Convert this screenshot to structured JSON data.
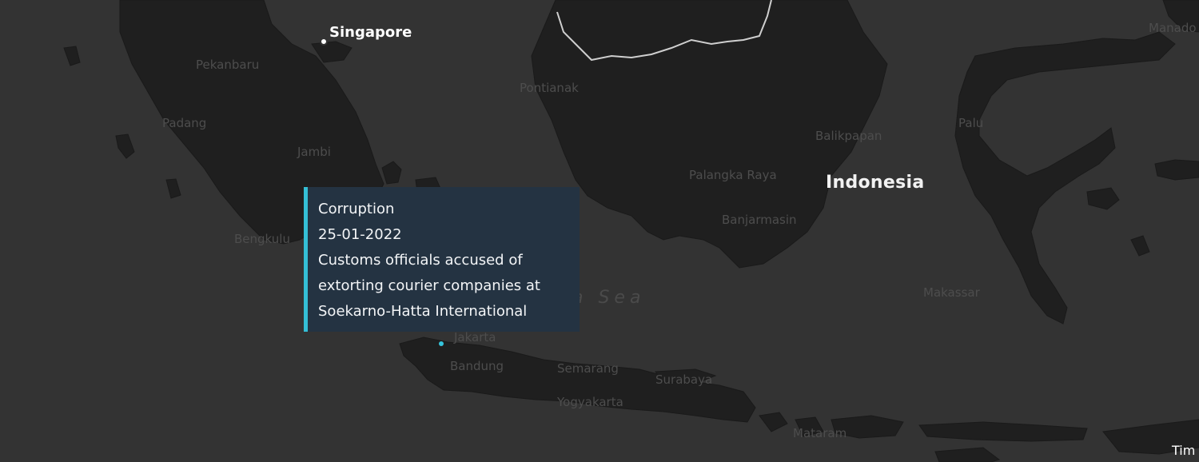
{
  "map": {
    "country_label": "Indonesia",
    "sea_label": "Java Sea",
    "capital_label": "Singapore",
    "city_labels": {
      "pekanbaru": "Pekanbaru",
      "padang": "Padang",
      "jambi": "Jambi",
      "bengkulu": "Bengkulu",
      "pontianak": "Pontianak",
      "palangka_raya": "Palangka Raya",
      "banjarmasin": "Banjarmasin",
      "balikpapan": "Balikpapan",
      "palu": "Palu",
      "makassar": "Makassar",
      "manado": "Manado",
      "jakarta": "Jakarta",
      "bandung": "Bandung",
      "semarang": "Semarang",
      "surabaya": "Surabaya",
      "yogyakarta": "Yogyakarta",
      "mataram": "Mataram"
    },
    "edge_label": "Tim",
    "colors": {
      "sea": "#333333",
      "land": "#1f1f1f",
      "border": "#cfcfcf",
      "marker_accent": "#35c4dc",
      "tooltip_bg": "#243342"
    }
  },
  "tooltip": {
    "category": "Corruption",
    "date": "25-01-2022",
    "description_line1": "Customs officials accused of",
    "description_line2": "extorting courier companies at",
    "description_line3": "Soekarno-Hatta International"
  }
}
